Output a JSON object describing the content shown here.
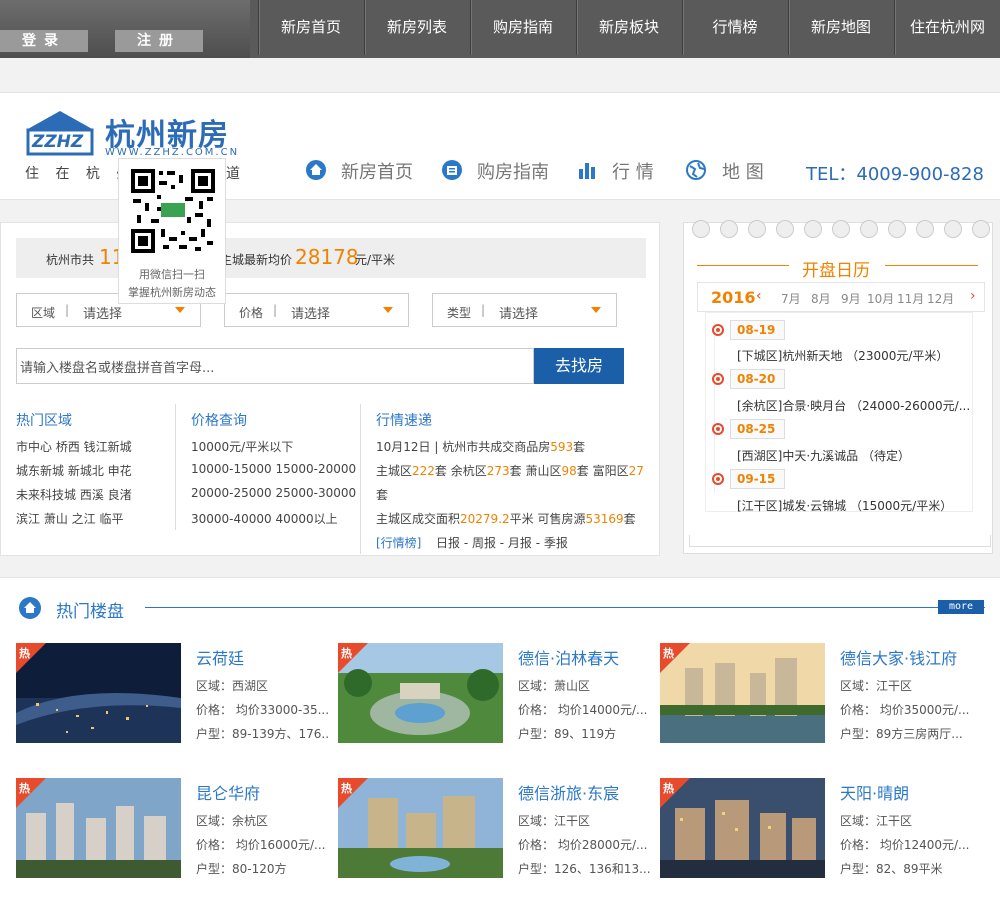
{
  "topbar": {
    "login": "登录",
    "register": "注册",
    "nav": [
      "新房首页",
      "新房列表",
      "购房指南",
      "新房板块",
      "行情榜",
      "新房地图",
      "住在杭州网"
    ]
  },
  "header": {
    "logo_mark": "ZZHZ",
    "logo_title": "杭州新房",
    "logo_url": "WWW.ZZHZ.COM.CN",
    "slogan_left": "住 在 杭 州",
    "slogan_right": "道",
    "nav": [
      "新房首页",
      "购房指南",
      "行 情",
      "地 图"
    ],
    "tel": "TEL：4009-900-828"
  },
  "qr": {
    "line1": "用微信扫一扫",
    "line2": "掌握杭州新房动态"
  },
  "stats": {
    "prefix": "杭州市共",
    "count": "11",
    "mid": "主城最新均价",
    "price": "28178",
    "unit": "元/平米"
  },
  "filters": [
    {
      "label": "区域",
      "value": "请选择"
    },
    {
      "label": "价格",
      "value": "请选择"
    },
    {
      "label": "类型",
      "value": "请选择"
    }
  ],
  "search": {
    "placeholder": "请输入楼盘名或楼盘拼音首字母...",
    "button": "去找房"
  },
  "hot_areas": {
    "title": "热门区域",
    "lines": [
      "市中心 桥西 钱江新城",
      "城东新城 新城北 申花",
      "未来科技城 西溪 良渚",
      "滨江 萧山 之江 临平"
    ]
  },
  "price_query": {
    "title": "价格查询",
    "lines": [
      "10000元/平米以下",
      "10000-15000 15000-20000",
      "20000-25000 25000-30000",
      "30000-40000 40000以上"
    ]
  },
  "market": {
    "title": "行情速递",
    "line1_a": "10月12日 | 杭州市共成交商品房",
    "line1_b": "593",
    "line1_c": "套",
    "line2": [
      {
        "t": "主城区",
        "n": "222",
        "s": "套 "
      },
      {
        "t": "余杭区",
        "n": "273",
        "s": "套 "
      },
      {
        "t": "萧山区",
        "n": "98",
        "s": "套 "
      },
      {
        "t": "富阳区",
        "n": "27",
        "s": ""
      }
    ],
    "line3": "套",
    "line4_a": "主城区成交面积",
    "line4_b": "20279.2",
    "line4_c": "平米 可售房源",
    "line4_d": "53169",
    "line4_e": "套",
    "tag": "[行情榜]",
    "reports": "日报 - 周报 - 月报 - 季报"
  },
  "calendar": {
    "title": "开盘日历",
    "year": "2016",
    "months": [
      "7月",
      "8月",
      "9月",
      "10月",
      "11月",
      "12月"
    ],
    "events": [
      {
        "date": "08-19",
        "text": "[下城区]杭州新天地 （23000元/平米）"
      },
      {
        "date": "08-20",
        "text": "[余杭区]合景·映月台 （24000-26000元/..."
      },
      {
        "date": "08-25",
        "text": "[西湖区]中天·九溪诚品 （待定）"
      },
      {
        "date": "09-15",
        "text": "[江干区]城发·云锦城 （15000元/平米）"
      }
    ]
  },
  "hot": {
    "title": "热门楼盘",
    "more": "more",
    "tag": "热",
    "items": [
      {
        "name": "云荷廷",
        "area": "区域：西湖区",
        "price": "价格：  均价33000-35...",
        "type": "户型：89-139方、176..."
      },
      {
        "name": "德信·泊林春天",
        "area": "区域：萧山区",
        "price": "价格：  均价14000元/...",
        "type": "户型：89、119方"
      },
      {
        "name": "德信大家·钱江府",
        "area": "区域：江干区",
        "price": "价格：  均价35000元/...",
        "type": "户型：89方三房两厅..."
      },
      {
        "name": "昆仑华府",
        "area": "区域：余杭区",
        "price": "价格：  均价16000元/...",
        "type": "户型：80-120方"
      },
      {
        "name": "德信浙旅·东宸",
        "area": "区域：江干区",
        "price": "价格：  均价28000元/...",
        "type": "户型：126、136和13..."
      },
      {
        "name": "天阳·晴朗",
        "area": "区域：江干区",
        "price": "价格：  均价12400元/...",
        "type": "户型：82、89平米"
      }
    ]
  },
  "colors": {
    "brand_blue": "#2c6cb6",
    "accent_orange": "#f08200",
    "button_blue": "#1a5fa8"
  }
}
